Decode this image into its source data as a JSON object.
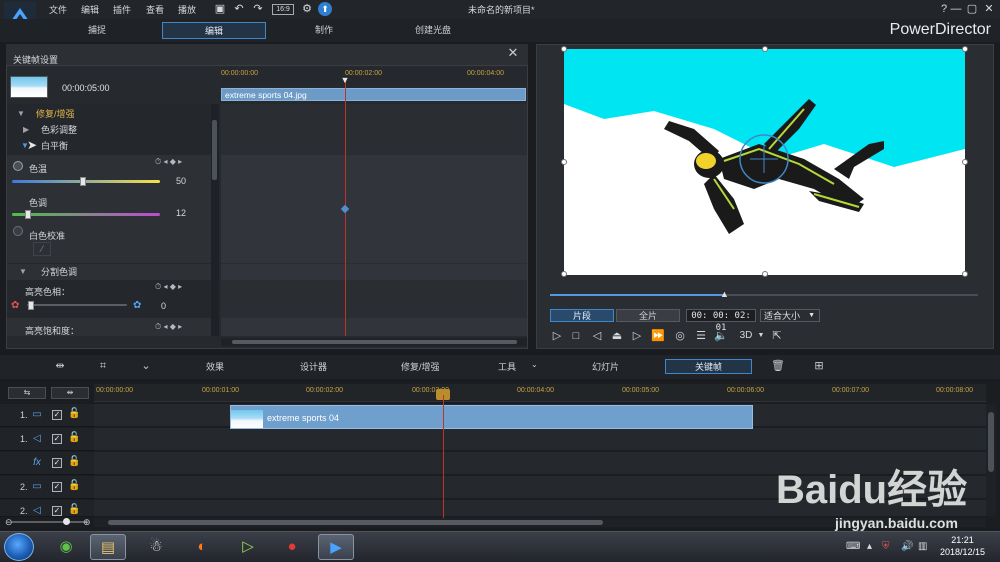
{
  "menu": {
    "file": "文件",
    "edit": "编辑",
    "plugins": "插件",
    "view": "查看",
    "playback": "播放",
    "aspect": "16:9"
  },
  "document_title": "未命名的新项目*",
  "window_controls": {
    "help": "?",
    "minimize": "—",
    "restore": "▢",
    "close": "✕"
  },
  "mode_tabs": {
    "capture": "捕捉",
    "edit": "编辑",
    "produce": "制作",
    "disc": "创建光盘"
  },
  "brand": "PowerDirector",
  "keyframe_panel": {
    "title": "关键帧设置",
    "duration": "00:00:05:00",
    "ruler": [
      "00:00:00:00",
      "00:00:02:00",
      "00:00:04:00"
    ],
    "clip_name": "extreme sports 04.jpg",
    "sections": {
      "fix_enhance": "修复/增强",
      "color_adjust": "色彩调整",
      "white_balance": "白平衡",
      "color_temp": "色温",
      "color_temp_value": "50",
      "tint": "色调",
      "tint_value": "12",
      "white_calibration": "白色校准",
      "split_toning": "分割色调",
      "highlight_hue": "高亮色相：",
      "highlight_hue_value": "0",
      "highlight_saturation": "高亮饱和度："
    }
  },
  "preview": {
    "clip_tab": "片段",
    "movie_tab": "全片",
    "timecode": "00: 00: 02: 01",
    "fit": "适合大小",
    "three_d": "3D"
  },
  "toolbar": {
    "effects": "效果",
    "designer": "设计器",
    "fix_enhance": "修复/增强",
    "tools": "工具",
    "slideshow": "幻灯片",
    "keyframe": "关键帧"
  },
  "timeline": {
    "ruler": [
      "00:00:00:00",
      "00:00:01:00",
      "00:00:02:00",
      "00:00:03:00",
      "00:00:04:00",
      "00:00:05:00",
      "00:00:06:00",
      "00:00:07:00",
      "00:00:08:00"
    ],
    "tracks": [
      "1.",
      "1.",
      "fx",
      "2.",
      "2."
    ],
    "clip_label": "extreme sports 04"
  },
  "taskbar": {
    "time": "21:21",
    "date": "2018/12/15"
  },
  "watermark": {
    "text": "jingyan.baidu.com",
    "logo": "Baidu经验"
  },
  "colors": {
    "accent_blue": "#3f87c8",
    "clip_blue": "#6e9fcd",
    "playhead_red": "#c0322d",
    "ruler_gold": "#c9a342",
    "preview_cyan": "#00e5f2"
  }
}
